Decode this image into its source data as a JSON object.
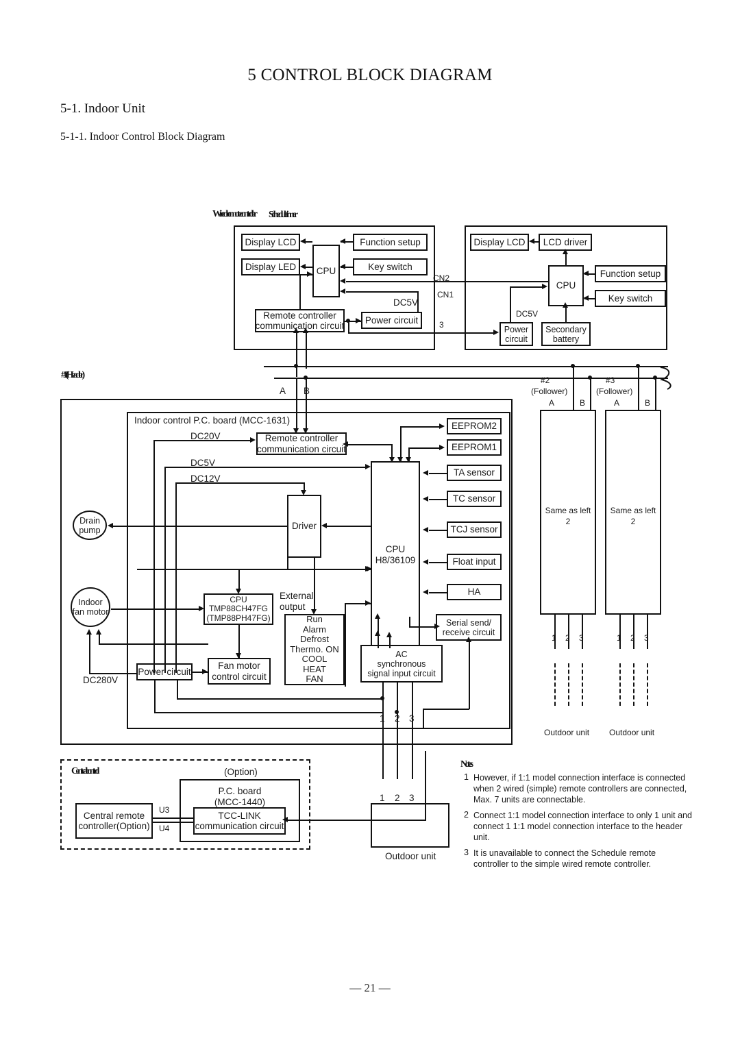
{
  "document": {
    "title": "5 CONTROL BLOCK DIAGRAM",
    "section_heading": "5-1.  Indoor Unit",
    "subsection_heading": "5-1-1.  Indoor Control Block Diagram",
    "page_number": "— 21 —"
  },
  "labels": {
    "wired_remote_controller": "Wired remote controller",
    "schedule_remote_controller": "Schedule timer",
    "header_unit": "#1 (Header)",
    "central_control_group": "Central control"
  },
  "remote_controller_left": {
    "display_lcd": "Display LCD",
    "display_led": "Display LED",
    "cpu": "CPU",
    "function_setup": "Function setup",
    "key_switch": "Key switch",
    "remote_comm": "Remote controller\ncommunication circuit",
    "power_circuit": "Power circuit",
    "dc5v": "DC5V"
  },
  "remote_controller_right": {
    "display_lcd": "Display LCD",
    "lcd_driver": "LCD driver",
    "cpu": "CPU",
    "function_setup": "Function setup",
    "key_switch": "Key switch",
    "power_circuit": "Power\ncircuit",
    "secondary_battery": "Secondary\nbattery",
    "dc5v": "DC5V"
  },
  "connectors": {
    "cn2": "CN2",
    "cn1": "CN1",
    "three": "3",
    "line_a": "A",
    "line_b": "B"
  },
  "indoor_board": {
    "title": "Indoor control P.C. board (MCC-1631)",
    "voltages": {
      "dc20v": "DC20V",
      "dc5v": "DC5V",
      "dc12v": "DC12V",
      "dc280v": "DC280V"
    },
    "drain_pump": "Drain\npump",
    "indoor_fan_motor": "Indoor\nfan motor",
    "remote_comm": "Remote controller\ncommunication circuit",
    "driver": "Driver",
    "cpu_main": "CPU\nH8/36109",
    "cpu_sub": "CPU\nTMP88CH47FG\n(TMP88PH47FG)",
    "fan_motor_control": "Fan motor\ncontrol circuit",
    "power_circuit": "Power circuit",
    "external_output_label": "External\noutput",
    "external_output_list": "Run\nAlarm\nDefrost\nThermo. ON\nCOOL\nHEAT\nFAN",
    "ac_sync": "AC\nsynchronous\nsignal input circuit",
    "serial_circuit": "Serial send/\nreceive circuit",
    "peripherals": [
      "EEPROM2",
      "EEPROM1",
      "TA sensor",
      "TC sensor",
      "TCJ sensor",
      "Float input",
      "HA"
    ],
    "terminals": [
      "1",
      "2",
      "3"
    ],
    "outdoor_unit": "Outdoor unit"
  },
  "follower_units": [
    {
      "id": "#2",
      "role": "(Follower)",
      "line_a": "A",
      "line_b": "B",
      "body": "Same as left\n2",
      "terminals": [
        "1",
        "2",
        "3"
      ],
      "outdoor_unit": "Outdoor unit"
    },
    {
      "id": "#3",
      "role": "(Follower)",
      "line_a": "A",
      "line_b": "B",
      "body": "Same as left\n2",
      "terminals": [
        "1",
        "2",
        "3"
      ],
      "outdoor_unit": "Outdoor unit"
    }
  ],
  "central_control": {
    "group_label": "Central control",
    "option_label": "(Option)",
    "pc_board": "P.C. board\n(MCC-1440)",
    "tcc_link": "TCC-LINK\ncommunication circuit",
    "central_remote": "Central remote\ncontroller(Option)",
    "u3": "U3",
    "u4": "U4"
  },
  "notes": {
    "heading": "Notes",
    "items": [
      {
        "num": "1",
        "text": "However, if  1:1 model connection interface  is connected when 2 wired (simple) remote controllers are connected, Max. 7 units are connectable."
      },
      {
        "num": "2",
        "text": "Connect  1:1 model connection interface  to only 1 unit and connect 1  1:1 model connection interface  to the header unit."
      },
      {
        "num": "3",
        "text": "It is unavailable to connect the Schedule remote controller to the simple wired remote controller."
      }
    ]
  },
  "colors": {
    "ink": "#111111",
    "paper": "#ffffff"
  }
}
